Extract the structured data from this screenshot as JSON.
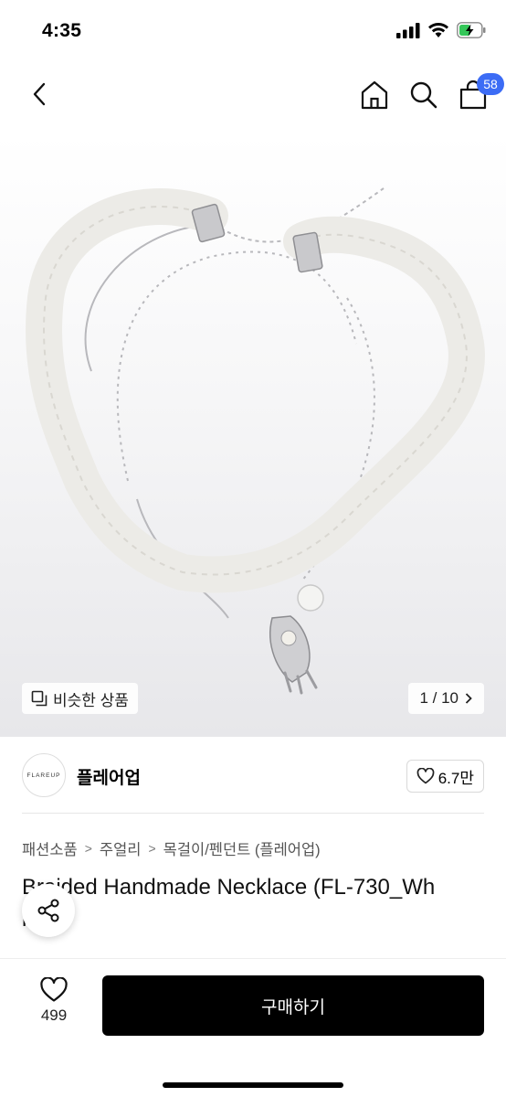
{
  "status": {
    "time": "4:35",
    "icons": [
      "signal-icon",
      "wifi-icon",
      "battery-charging-icon"
    ]
  },
  "nav": {
    "icons": [
      "back-icon",
      "home-icon",
      "search-icon",
      "cart-icon"
    ],
    "cart_count": "58"
  },
  "image": {
    "similar_label": "비슷한 상품",
    "counter": "1 / 10"
  },
  "brand": {
    "logo_text": "FLAREUP",
    "name": "플레어업",
    "likes": "6.7만"
  },
  "breadcrumb": [
    "패션소품",
    "주얼리",
    "목걸이/펜던트 (플레어업)"
  ],
  "product": {
    "title_line1": "Braided Handmade Necklace (FL-730_Wh",
    "title_line2": "it"
  },
  "bottom": {
    "wish_count": "499",
    "buy_label": "구매하기"
  },
  "colors": {
    "accent": "#3c6cf5",
    "buy_button": "#000000"
  }
}
